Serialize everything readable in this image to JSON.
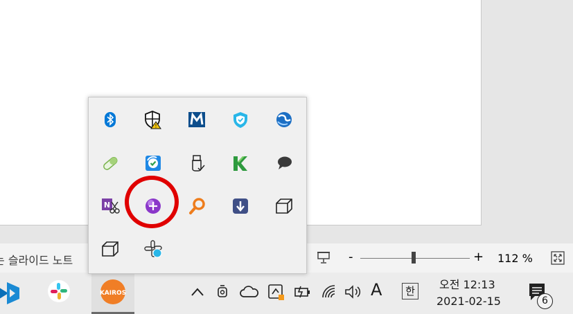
{
  "status_bar": {
    "notes_label": "슬라이드 노트",
    "zoom_minus": "-",
    "zoom_plus": "+",
    "zoom_level": "112 %",
    "zoom_fraction": 0.49
  },
  "taskbar": {
    "pinned": [
      {
        "name": "vscode-icon"
      },
      {
        "name": "slack-icon"
      },
      {
        "name": "kairos-icon",
        "label": "KAIROS"
      }
    ],
    "tray": {
      "ime_letter": "A",
      "ime_mode": "한",
      "clock_time": "오전 12:13",
      "clock_date": "2021-02-15",
      "notification_count": "6"
    }
  },
  "tray_popup": {
    "icons": [
      "bluetooth-icon",
      "windows-security-icon",
      "malwarebytes-icon",
      "shield-check-icon",
      "globe-sync-icon",
      "pill-icon",
      "sync-check-icon",
      "usb-eject-icon",
      "kaspersky-icon",
      "chat-bubble-icon",
      "onenote-clip-icon",
      "purple-orb-icon",
      "magnifier-icon",
      "download-icon",
      "cube-icon",
      "cube-outline-icon",
      "slack-status-icon"
    ],
    "highlighted": "purple-orb-icon"
  },
  "colors": {
    "highlight": "#e00000",
    "accent_blue": "#0078d7"
  }
}
